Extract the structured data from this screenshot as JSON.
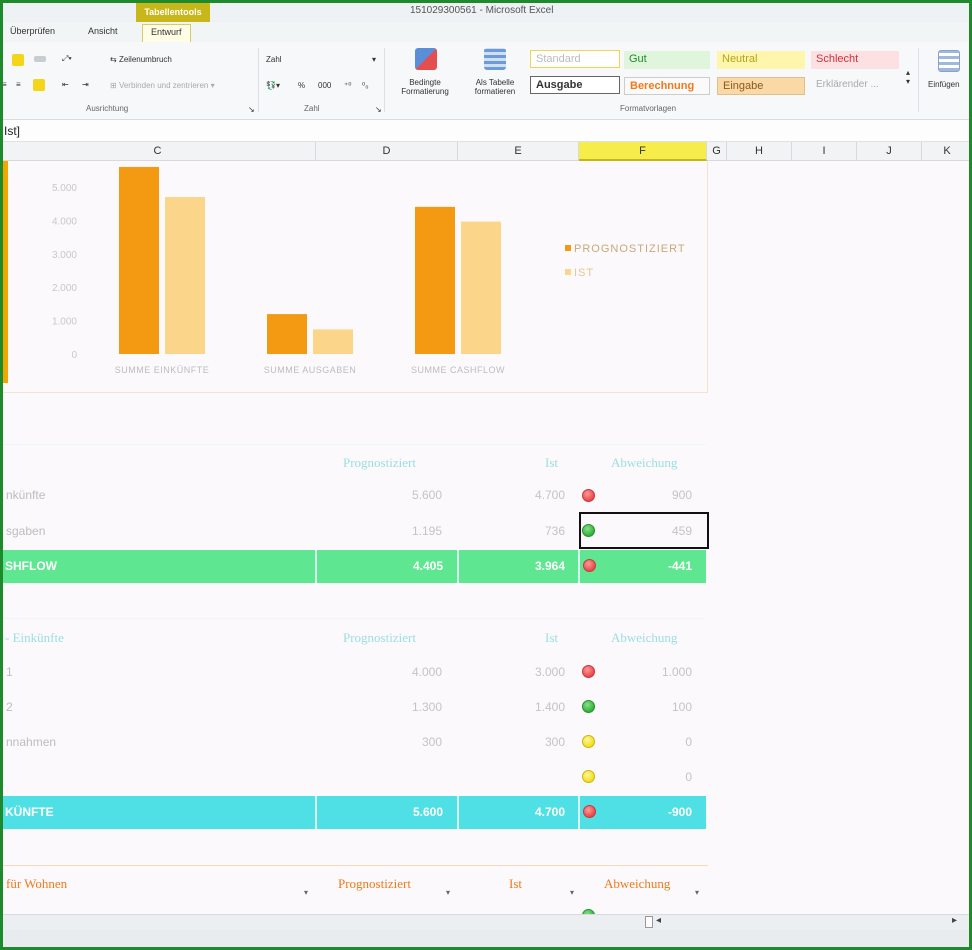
{
  "window": {
    "context_tab": "Tabellentools",
    "title": "151029300561 - Microsoft Excel"
  },
  "ribbon_tabs": [
    "Überprüfen",
    "Ansicht",
    "Entwurf"
  ],
  "ribbon": {
    "wrap_text": "Zeilenumbruch",
    "merge_center": "Verbinden und zentrieren",
    "number_format": "Zahl",
    "percent": "%",
    "thousands": "000",
    "conditional_formatting": [
      "Bedingte",
      "Formatierung"
    ],
    "as_table": [
      "Als Tabelle",
      "formatieren"
    ],
    "insert": "Einfügen",
    "group_alignment": "Ausrichtung",
    "group_number": "Zahl",
    "group_styles": "Formatvorlagen",
    "styles": {
      "standard": "Standard",
      "gut": "Gut",
      "neutral": "Neutral",
      "schlecht": "Schlecht",
      "ausgabe": "Ausgabe",
      "berechnung": "Berechnung",
      "eingabe": "Eingabe",
      "erklaerend": "Erklärender ..."
    }
  },
  "formula_bar": {
    "content": "Ist]"
  },
  "columns": [
    "C",
    "D",
    "E",
    "F",
    "G",
    "H",
    "I",
    "J",
    "K"
  ],
  "selected_column": "F",
  "colors": {
    "prognostiziert": "#f39a12",
    "ist": "#fbd58a",
    "green_band": "#5ee790",
    "cyan_band": "#4fe0e5"
  },
  "chart_data": {
    "type": "bar",
    "categories": [
      "SUMME EINKÜNFTE",
      "SUMME AUSGABEN",
      "SUMME CASHFLOW"
    ],
    "series": [
      {
        "name": "PROGNOSTIZIERT",
        "values": [
          5600,
          1195,
          4405
        ]
      },
      {
        "name": "IST",
        "values": [
          4700,
          736,
          3964
        ]
      }
    ],
    "y_ticks": [
      "0",
      "1.000",
      "2.000",
      "3.000",
      "4.000",
      "5.000"
    ],
    "ylim": [
      0,
      5000
    ],
    "legend": "right",
    "grid": false
  },
  "summary": {
    "headers": {
      "prognostiziert": "Prognostiziert",
      "ist": "Ist",
      "abweichung": "Abweichung"
    },
    "rows": [
      {
        "label": "nkünfte",
        "prog": "5.600",
        "ist": "4.700",
        "abw": "900",
        "status": "red"
      },
      {
        "label": "sgaben",
        "prog": "1.195",
        "ist": "736",
        "abw": "459",
        "status": "green"
      }
    ],
    "total": {
      "label": "SHFLOW",
      "prog": "4.405",
      "ist": "3.964",
      "abw": "-441",
      "status": "red"
    }
  },
  "income": {
    "title": "Einkünfte",
    "headers": {
      "prognostiziert": "Prognostiziert",
      "ist": "Ist",
      "abweichung": "Abweichung"
    },
    "rows": [
      {
        "label": "1",
        "prog": "4.000",
        "ist": "3.000",
        "abw": "1.000",
        "status": "red"
      },
      {
        "label": "2",
        "prog": "1.300",
        "ist": "1.400",
        "abw": "100",
        "status": "green"
      },
      {
        "label": "nnahmen",
        "prog": "300",
        "ist": "300",
        "abw": "0",
        "status": "yellow"
      },
      {
        "label": "",
        "prog": "",
        "ist": "",
        "abw": "0",
        "status": "yellow"
      }
    ],
    "total": {
      "label": "KÜNFTE",
      "prog": "5.600",
      "ist": "4.700",
      "abw": "-900",
      "status": "red"
    }
  },
  "housing": {
    "title": "für Wohnen",
    "headers": {
      "prognostiziert": "Prognostiziert",
      "ist": "Ist",
      "abweichung": "Abweichung"
    }
  }
}
